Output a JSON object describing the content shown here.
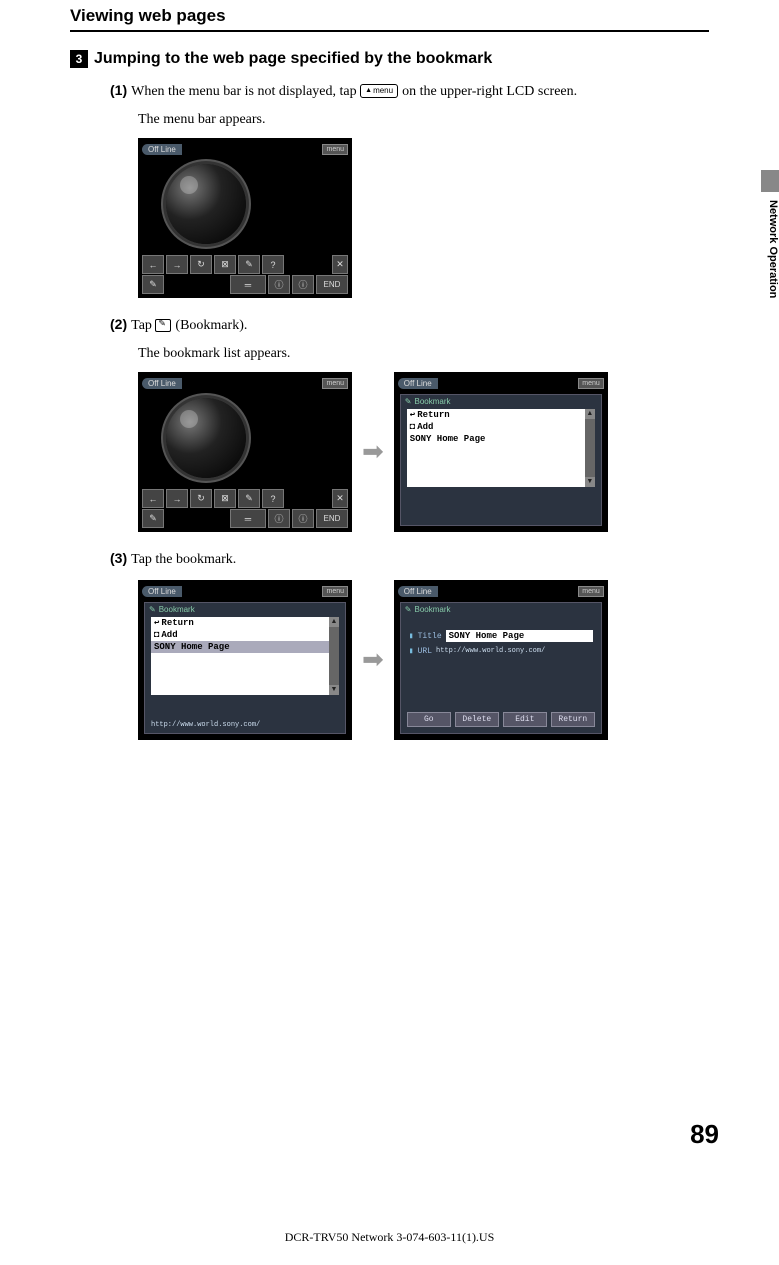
{
  "page": {
    "title": "Viewing web pages",
    "side_tab": "Network Operation",
    "page_number": "89",
    "footer": "DCR-TRV50 Network 3-074-603-11(1).US"
  },
  "section": {
    "num": "3",
    "heading": "Jumping to the web page specified by the bookmark"
  },
  "steps": {
    "s1": {
      "label": "(1)",
      "text_a": "When the menu bar is not displayed, tap ",
      "text_b": " on the upper-right LCD screen.",
      "text_c": "The menu bar appears.",
      "menu_label": "menu"
    },
    "s2": {
      "label": "(2)",
      "text_a": "Tap ",
      "text_b": " (Bookmark).",
      "text_c": "The bookmark list appears."
    },
    "s3": {
      "label": "(3)",
      "text_a": "Tap the bookmark."
    }
  },
  "ui": {
    "offline": "Off Line",
    "menu": "menu",
    "end": "END",
    "bookmark_title": "Bookmark",
    "bk_return": "Return",
    "bk_add": "Add",
    "bk_sony": "SONY Home Page",
    "url_sony": "http://www.world.sony.com/",
    "title_label": "Title",
    "url_label": "URL",
    "btn_go": "Go",
    "btn_delete": "Delete",
    "btn_edit": "Edit",
    "btn_return": "Return",
    "tb_back": "←",
    "tb_fwd": "→",
    "tb_reload": "↻",
    "tb_stop": "⊠",
    "tb_bookmark": "✎",
    "tb_help": "?",
    "tb_close": "✕",
    "tb_url": "═",
    "tb_info": "ⓘ",
    "arrow_up": "▲",
    "arrow_dn": "▼"
  }
}
